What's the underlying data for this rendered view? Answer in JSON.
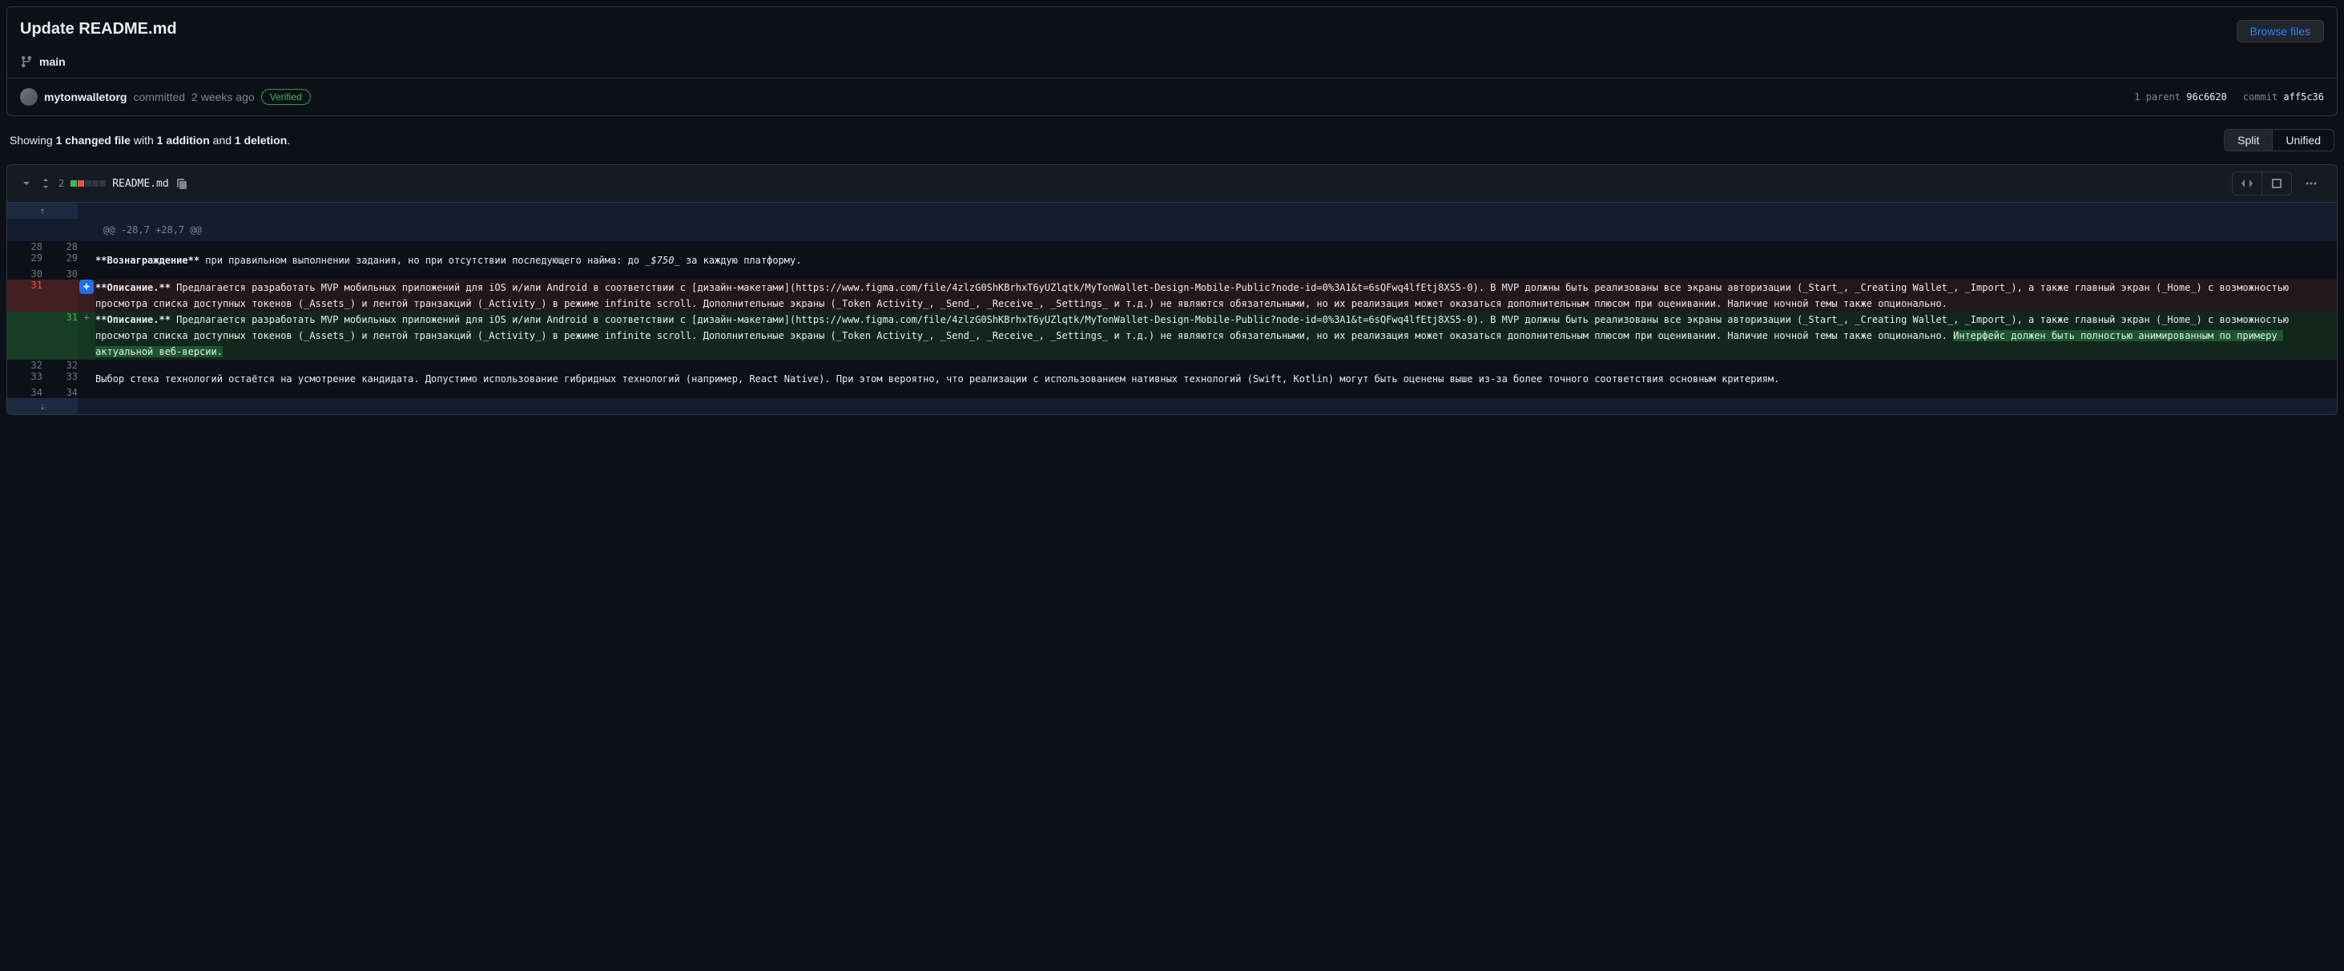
{
  "commit": {
    "title": "Update README.md",
    "browse_files": "Browse files",
    "branch": "main",
    "author": "mytonwalletorg",
    "action": "committed",
    "time": "2 weeks ago",
    "verified": "Verified",
    "parent_label": "1 parent",
    "parent_sha": "96c6620",
    "commit_label": "commit",
    "commit_sha": "aff5c36"
  },
  "stats": {
    "prefix": "Showing ",
    "files": "1 changed file",
    "with": " with ",
    "additions": "1 addition",
    "and": " and ",
    "deletions": "1 deletion",
    "suffix": "."
  },
  "view": {
    "split": "Split",
    "unified": "Unified"
  },
  "file": {
    "changes": "2",
    "name": "README.md"
  },
  "diff": {
    "hunk": "@@ -28,7 +28,7 @@",
    "rows": [
      {
        "type": "context",
        "old": "28",
        "new": "28",
        "content": ""
      },
      {
        "type": "context",
        "old": "29",
        "new": "29",
        "content_html": "<span class=\"code-strong\">**Вознаграждение**</span> при правильном выполнении задания, но при отсутствии последующего найма: до <span class=\"code-em\">_$750_</span> за каждую платформу."
      },
      {
        "type": "context",
        "old": "30",
        "new": "30",
        "content": ""
      },
      {
        "type": "del",
        "old": "31",
        "new": "",
        "content_html": "<span class=\"code-strong\">**Описание.**</span> Предлагается разработать MVP мобильных приложений для iOS и/или Android в соответствии с [дизайн-макетами](https://www.figma.com/file/4zlzG0ShKBrhxT6yUZlqtk/MyTonWallet-Design-Mobile-Public?node-id=0%3A1&t=6sQFwq4lfEtj8XS5-0). В MVP должны быть реализованы все экраны авторизации (_Start_, _Creating Wallet_, _Import_), а также главный экран (_Home_) с возможностью просмотра списка доступных токенов (_Assets_) и лентой транзакций (_Activity_) в режиме infinite scroll. Дополнительные экраны (_Token Activity_, _Send_, _Receive_, _Settings_ и т.д.) не являются обязательными, но их реализация может оказаться дополнительным плюсом при оценивании. Наличие ночной темы также опционально."
      },
      {
        "type": "add",
        "old": "",
        "new": "31",
        "content_html": "<span class=\"code-strong\">**Описание.**</span> Предлагается разработать MVP мобильных приложений для iOS и/или Android в соответствии с [дизайн-макетами](https://www.figma.com/file/4zlzG0ShKBrhxT6yUZlqtk/MyTonWallet-Design-Mobile-Public?node-id=0%3A1&t=6sQFwq4lfEtj8XS5-0). В MVP должны быть реализованы все экраны авторизации (_Start_, _Creating Wallet_, _Import_), а также главный экран (_Home_) с возможностью просмотра списка доступных токенов (_Assets_) и лентой транзакций (_Activity_) в режиме infinite scroll. Дополнительные экраны (_Token Activity_, _Send_, _Receive_, _Settings_ и т.д.) не являются обязательными, но их реализация может оказаться дополнительным плюсом при оценивании. Наличие ночной темы также опционально. <span class=\"highlight-add\">Интерфейс должен быть полностью анимированным по примеру актуальной веб-версии.</span>"
      },
      {
        "type": "context",
        "old": "32",
        "new": "32",
        "content": ""
      },
      {
        "type": "context",
        "old": "33",
        "new": "33",
        "content": "Выбор стека технологий остаётся на усмотрение кандидата. Допустимо использование гибридных технологий (например, React Native). При этом вероятно, что реализации с использованием нативных технологий (Swift, Kotlin) могут быть оценены выше из-за более точного соответствия основным критериям."
      },
      {
        "type": "context",
        "old": "34",
        "new": "34",
        "content": ""
      }
    ]
  }
}
